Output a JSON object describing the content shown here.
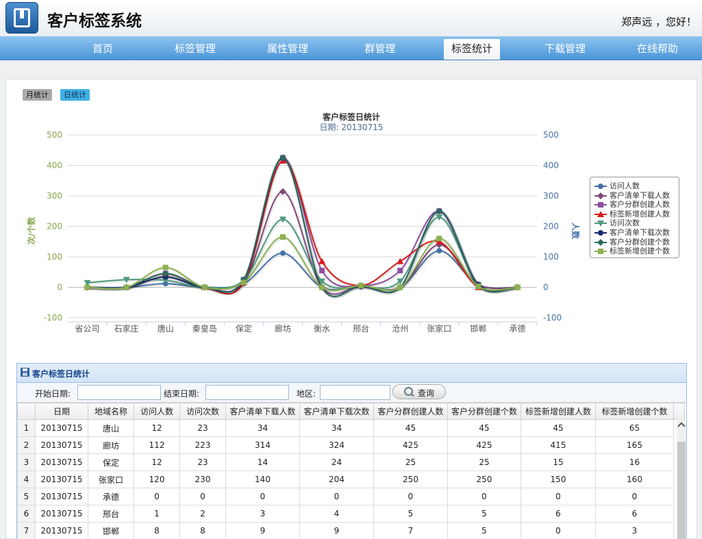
{
  "header": {
    "title": "客户标签系统",
    "greeting": "郑声远 ，您好！"
  },
  "nav": {
    "items": [
      "首页",
      "标签管理",
      "属性管理",
      "群管理",
      "标签统计",
      "下载管理",
      "在线帮助"
    ],
    "active": "标签统计"
  },
  "stat_tabs": {
    "month": "月统计",
    "day": "日统计"
  },
  "chart_data": {
    "type": "line",
    "title": "客户标签日统计",
    "subtitle": "日期: 20130715",
    "ylabel_left": "次/个数",
    "ylabel_right": "人数",
    "ylim": [
      -100,
      500
    ],
    "yticks": [
      -100,
      0,
      100,
      200,
      300,
      400,
      500
    ],
    "grid": true,
    "legend_position": "right",
    "categories": [
      "省公司",
      "石家庄",
      "唐山",
      "秦皇岛",
      "保定",
      "廊坊",
      "衡水",
      "邢台",
      "沧州",
      "张家口",
      "邯郸",
      "承德"
    ],
    "series": [
      {
        "name": "访问人数",
        "color": "#4572a7",
        "marker": "circle",
        "values": [
          0,
          0,
          12,
          0,
          12,
          112,
          0,
          1,
          0,
          120,
          8,
          0
        ]
      },
      {
        "name": "客户清单下载人数",
        "color": "#80477a",
        "marker": "diamond",
        "values": [
          0,
          0,
          34,
          0,
          14,
          314,
          0,
          3,
          0,
          140,
          9,
          0
        ]
      },
      {
        "name": "客户分群创建人数",
        "color": "#8e4fa0",
        "marker": "square",
        "values": [
          0,
          0,
          45,
          0,
          25,
          425,
          55,
          5,
          55,
          250,
          7,
          0
        ]
      },
      {
        "name": "标签新增创建人数",
        "color": "#d81b1b",
        "marker": "triangle",
        "values": [
          0,
          0,
          45,
          0,
          15,
          415,
          85,
          6,
          85,
          150,
          0,
          0
        ]
      },
      {
        "name": "访问次数",
        "color": "#4f9a7d",
        "marker": "triangle-down",
        "values": [
          15,
          25,
          23,
          0,
          23,
          223,
          20,
          2,
          20,
          230,
          8,
          0
        ]
      },
      {
        "name": "客户清单下载次数",
        "color": "#1b2a6b",
        "marker": "circle",
        "values": [
          0,
          0,
          34,
          0,
          24,
          424,
          0,
          4,
          0,
          250,
          9,
          0
        ]
      },
      {
        "name": "客户分群创建个数",
        "color": "#2b6a62",
        "marker": "diamond",
        "values": [
          0,
          0,
          45,
          0,
          25,
          425,
          0,
          5,
          0,
          250,
          5,
          0
        ]
      },
      {
        "name": "标签新增创建个数",
        "color": "#8db050",
        "marker": "square",
        "values": [
          0,
          0,
          65,
          0,
          16,
          165,
          0,
          6,
          0,
          160,
          3,
          0
        ]
      }
    ]
  },
  "panel": {
    "title": "客户标签日统计",
    "start_label": "开始日期:",
    "start_value": "",
    "end_label": "结束日期:",
    "end_value": "",
    "region_label": "地区:",
    "region_value": "",
    "query_label": "查询"
  },
  "table": {
    "columns": [
      "日期",
      "地域名称",
      "访问人数",
      "访问次数",
      "客户清单下载人数",
      "客户清单下载次数",
      "客户分群创建人数",
      "客户分群创建个数",
      "标签新增创建人数",
      "标签新增创建个数"
    ],
    "rows": [
      [
        "1",
        "20130715",
        "唐山",
        "12",
        "23",
        "34",
        "34",
        "45",
        "45",
        "45",
        "65"
      ],
      [
        "2",
        "20130715",
        "廊坊",
        "112",
        "223",
        "314",
        "324",
        "425",
        "425",
        "415",
        "165"
      ],
      [
        "3",
        "20130715",
        "保定",
        "12",
        "23",
        "14",
        "24",
        "25",
        "25",
        "15",
        "16"
      ],
      [
        "4",
        "20130715",
        "张家口",
        "120",
        "230",
        "140",
        "204",
        "250",
        "250",
        "150",
        "160"
      ],
      [
        "5",
        "20130715",
        "承德",
        "0",
        "0",
        "0",
        "0",
        "0",
        "0",
        "0",
        "0"
      ],
      [
        "6",
        "20130715",
        "邢台",
        "1",
        "2",
        "3",
        "4",
        "5",
        "5",
        "6",
        "6"
      ],
      [
        "7",
        "20130715",
        "邯郸",
        "8",
        "8",
        "9",
        "9",
        "7",
        "5",
        "0",
        "3"
      ]
    ]
  }
}
